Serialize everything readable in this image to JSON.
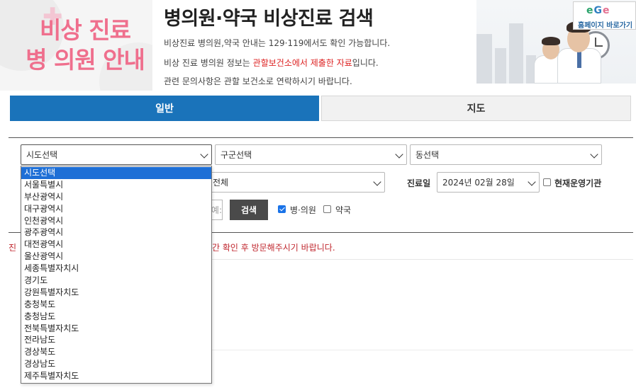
{
  "banner": {
    "heading_line1": "비상 진료",
    "heading_line2": "병 의원 안내",
    "title": "병의원·약국 비상진료 검색",
    "info_line1": "비상진료 병의원,약국 안내는 129·119에서도 확인 가능합니다.",
    "info_line2_pre": "비상 진료 병의원 정보는 ",
    "info_line2_highlight": "관할보건소에서 제출한 자료",
    "info_line2_post": "입니다.",
    "info_line3": "관련 문의사항은 관할 보건소로 연락하시기 바랍니다.",
    "home_logo": [
      "e",
      "G",
      "e"
    ],
    "home_link_label": "홈페이지 바로가기",
    "colors": {
      "heading": "#ef6f8d",
      "highlight": "#d22222"
    }
  },
  "tabs": [
    {
      "label": "일반",
      "active": true
    },
    {
      "label": "지도",
      "active": false
    }
  ],
  "search": {
    "sido_value": "시도선택",
    "gugun_value": "구군선택",
    "dong_value": "동선택",
    "type_value": "전체",
    "date_label": "진료일",
    "date_value": "2024년 02월 28일",
    "open_now_label": "현재운영기관",
    "open_now_checked": false,
    "name_placeholder": "예:",
    "search_button": "검색",
    "hospital_label": "병·의원",
    "hospital_checked": true,
    "pharmacy_label": "약국",
    "pharmacy_checked": false
  },
  "notice": {
    "lead": "진",
    "rest": "간 확인 후 방문해주시기 바랍니다."
  },
  "sido_dropdown": {
    "selected_index": 0,
    "options": [
      "시도선택",
      "서울특별시",
      "부산광역시",
      "대구광역시",
      "인천광역시",
      "광주광역시",
      "대전광역시",
      "울산광역시",
      "세종특별자치시",
      "경기도",
      "강원특별자치도",
      "충청북도",
      "충청남도",
      "전북특별자치도",
      "전라남도",
      "경상북도",
      "경상남도",
      "제주특별자치도"
    ]
  },
  "accent_colors": {
    "tab_active": "#1a73ba",
    "dropdown_selected": "#1e6fd6",
    "notice": "#c0282f"
  }
}
